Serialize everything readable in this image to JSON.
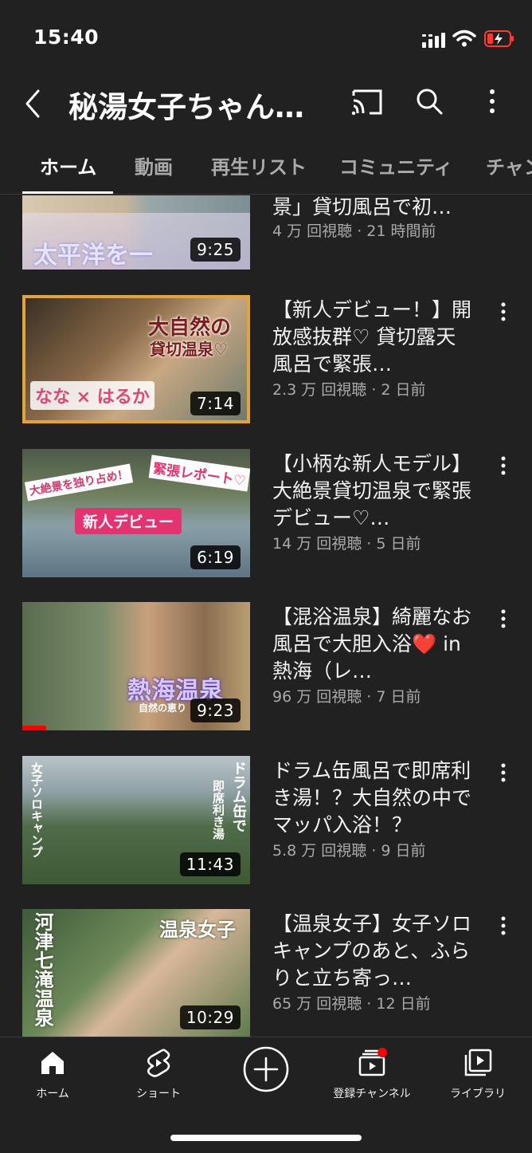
{
  "status": {
    "time": "15:40"
  },
  "header": {
    "title": "秘湯女子ちゃん…"
  },
  "tabs": [
    {
      "label": "ホーム",
      "active": true
    },
    {
      "label": "動画"
    },
    {
      "label": "再生リスト"
    },
    {
      "label": "コミュニティ"
    },
    {
      "label": "チャンネル"
    }
  ],
  "videos": [
    {
      "title": "景」貸切風呂で初…",
      "meta": "4 万 回視聴 · 21 時間前",
      "duration": "9:25",
      "captions": [
        "太平洋を一"
      ]
    },
    {
      "title": "【新人デビュー！】開放感抜群♡ 貸切露天風呂で緊張…",
      "meta": "2.3 万 回視聴 · 2 日前",
      "duration": "7:14",
      "captions": [
        "大自然の",
        "貸切温泉♡",
        "なな × はるか"
      ]
    },
    {
      "title": "【小柄な新人モデル】大絶景貸切温泉で緊張デビュー♡…",
      "meta": "14 万 回視聴 · 5 日前",
      "duration": "6:19",
      "captions": [
        "大絶景を独り占め！",
        "緊張レポート♡",
        "新人デビュー"
      ]
    },
    {
      "title": "【混浴温泉】綺麗なお風呂で大胆入浴❤️ in熱海（レ…",
      "meta": "96 万 回視聴 · 7 日前",
      "duration": "9:23",
      "captions": [
        "熱海温泉",
        "自然の恵り"
      ]
    },
    {
      "title": "ドラム缶風呂で即席利き湯！？大自然の中でマッパ入浴！？",
      "meta": "5.8 万 回視聴 · 9 日前",
      "duration": "11:43",
      "captions": [
        "女子ソロキャンプ",
        "ドラム缶で",
        "即席利き湯"
      ]
    },
    {
      "title": "【温泉女子】女子ソロキャンプのあと、ふらりと立ち寄っ…",
      "meta": "65 万 回視聴 · 12 日前",
      "duration": "10:29",
      "captions": [
        "温泉女子",
        "河津七滝温泉"
      ]
    }
  ],
  "nav": [
    {
      "label": "ホーム",
      "icon": "home-icon"
    },
    {
      "label": "ショート",
      "icon": "shorts-icon"
    },
    {
      "label": "",
      "icon": "create-icon"
    },
    {
      "label": "登録チャンネル",
      "icon": "subscriptions-icon"
    },
    {
      "label": "ライブラリ",
      "icon": "library-icon"
    }
  ],
  "colors": {
    "background": "#212121",
    "accent": "#ff0000",
    "secondary_text": "#aaaaaa"
  }
}
